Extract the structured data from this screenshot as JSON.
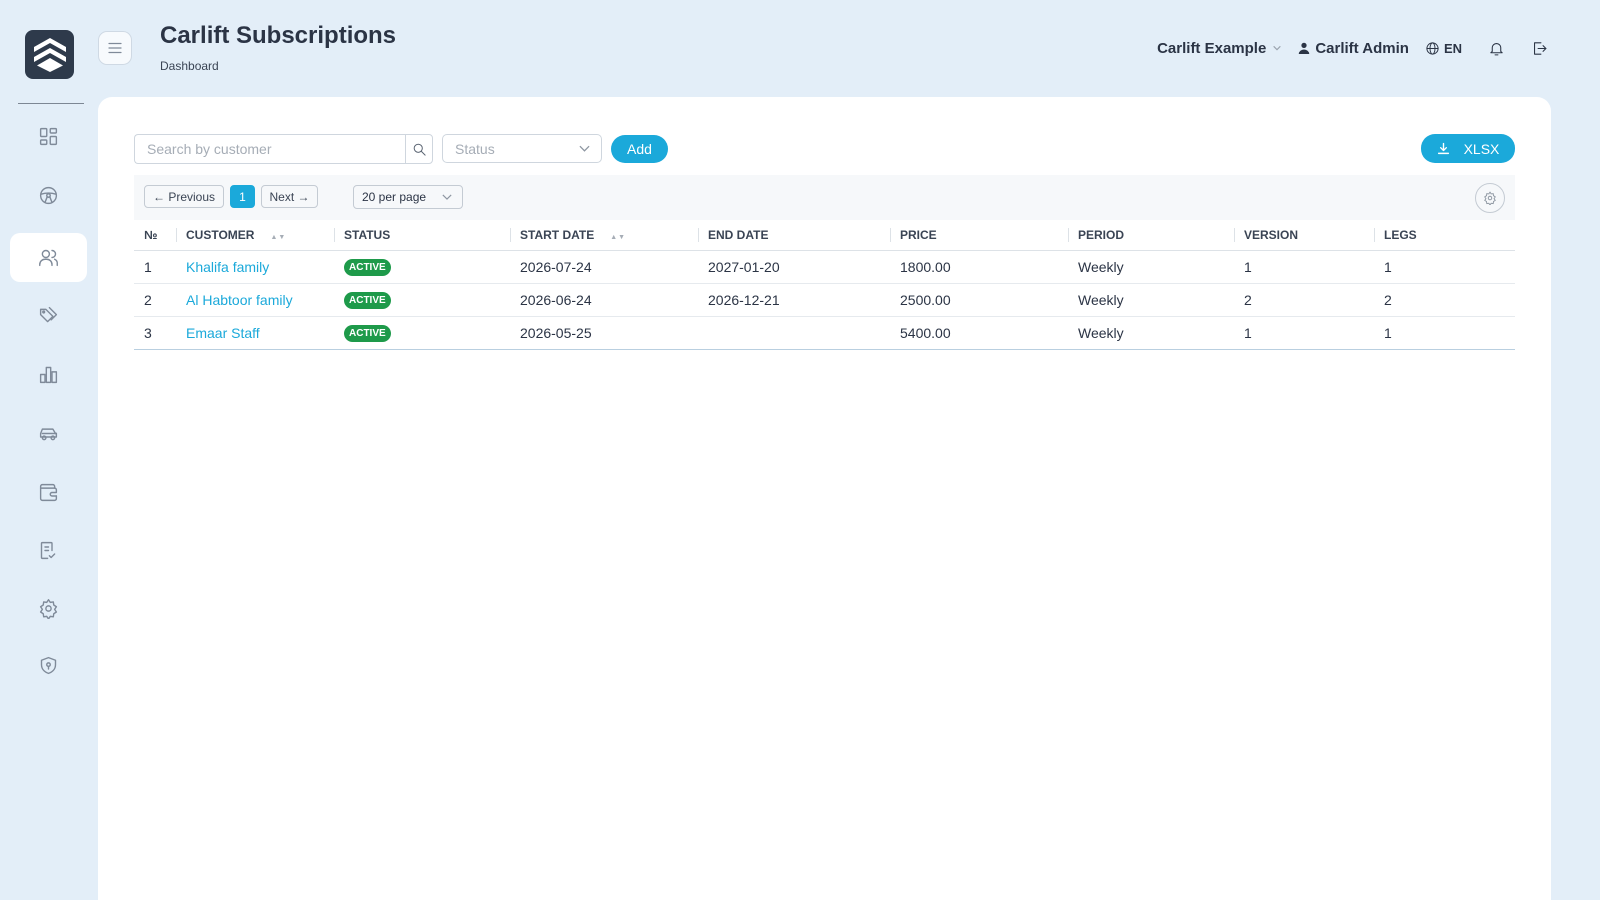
{
  "app": {
    "title": "Carlift Subscriptions",
    "breadcrumb": "Dashboard"
  },
  "header": {
    "org_name": "Carlift Example",
    "user_name": "Carlift Admin",
    "language": "EN"
  },
  "sidebar": {
    "items": [
      {
        "icon": "dashboard-icon"
      },
      {
        "icon": "steering-wheel-icon"
      },
      {
        "icon": "users-icon",
        "active": true
      },
      {
        "icon": "tags-icon"
      },
      {
        "icon": "bar-chart-icon"
      },
      {
        "icon": "car-icon"
      },
      {
        "icon": "wallet-icon"
      },
      {
        "icon": "checklist-icon"
      },
      {
        "icon": "gear-icon"
      },
      {
        "icon": "shield-icon"
      }
    ]
  },
  "filters": {
    "search_placeholder": "Search by customer",
    "status_placeholder": "Status",
    "add_label": "Add",
    "export_label": "XLSX"
  },
  "pagination": {
    "prev_label": "← Previous",
    "current_page": "1",
    "next_label": "Next →",
    "per_page": "20 per page"
  },
  "table": {
    "columns": [
      "№",
      "CUSTOMER",
      "STATUS",
      "START DATE",
      "END DATE",
      "PRICE",
      "PERIOD",
      "VERSION",
      "LEGS"
    ],
    "rows": [
      {
        "no": "1",
        "customer": "Khalifa family",
        "status": "ACTIVE",
        "start": "2026-07-24",
        "end": "2027-01-20",
        "price": "1800.00",
        "period": "Weekly",
        "version": "1",
        "legs": "1"
      },
      {
        "no": "2",
        "customer": "Al Habtoor family",
        "status": "ACTIVE",
        "start": "2026-06-24",
        "end": "2026-12-21",
        "price": "2500.00",
        "period": "Weekly",
        "version": "2",
        "legs": "2"
      },
      {
        "no": "3",
        "customer": "Emaar Staff",
        "status": "ACTIVE",
        "start": "2026-05-25",
        "end": "",
        "price": "5400.00",
        "period": "Weekly",
        "version": "1",
        "legs": "1"
      }
    ]
  },
  "colors": {
    "accent": "#1ba9da",
    "active_badge": "#1e9a4a",
    "background": "#e3eef8",
    "logo_bg": "#2e3a4b"
  }
}
